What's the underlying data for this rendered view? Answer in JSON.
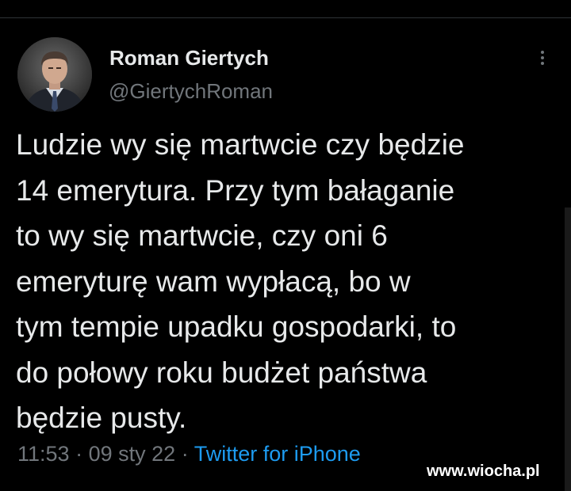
{
  "tweet": {
    "author": {
      "display_name": "Roman Giertych",
      "handle": "@GiertychRoman"
    },
    "text": "Ludzie wy się martwcie czy będzie\n14 emerytura. Przy tym bałaganie\nto wy się martwcie, czy oni 6\nemeryturę wam wypłacą, bo w\ntym tempie upadku gospodarki, to\ndo połowy roku budżet państwa\nbędzie pusty.",
    "time": "11:53",
    "separator": "·",
    "date": "09 sty 22",
    "source": "Twitter for iPhone"
  },
  "icons": {
    "more": "more-vertical-icon"
  },
  "watermark": "www.wiocha.pl",
  "colors": {
    "background": "#000000",
    "text": "#e7e9ea",
    "secondary": "#71767b",
    "link": "#1d9bf0"
  }
}
